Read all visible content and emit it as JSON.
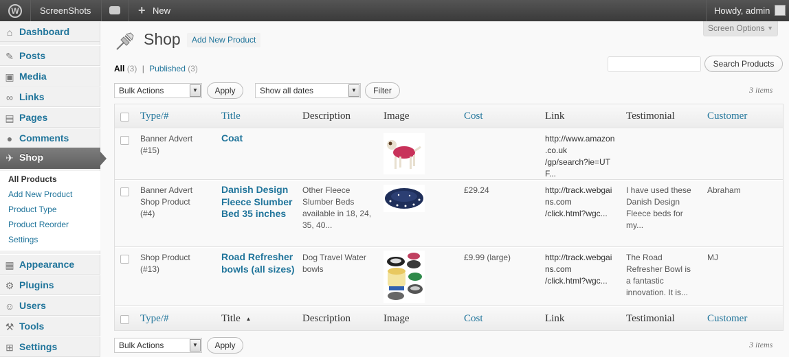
{
  "adminbar": {
    "site_name": "ScreenShots",
    "new_label": "New",
    "howdy": "Howdy, admin"
  },
  "screen_options": "Screen Options",
  "sidebar": {
    "items": [
      {
        "label": "Dashboard",
        "icon": "dashboard-icon"
      },
      {
        "label": "Posts",
        "icon": "pin-icon"
      },
      {
        "label": "Media",
        "icon": "media-icon"
      },
      {
        "label": "Links",
        "icon": "link-icon"
      },
      {
        "label": "Pages",
        "icon": "pages-icon"
      },
      {
        "label": "Comments",
        "icon": "comment-icon"
      },
      {
        "label": "Shop",
        "icon": "shop-icon"
      },
      {
        "label": "Appearance",
        "icon": "appearance-icon"
      },
      {
        "label": "Plugins",
        "icon": "plugin-icon"
      },
      {
        "label": "Users",
        "icon": "users-icon"
      },
      {
        "label": "Tools",
        "icon": "tools-icon"
      },
      {
        "label": "Settings",
        "icon": "settings-icon"
      }
    ],
    "submenu": [
      "All Products",
      "Add New Product",
      "Product Type",
      "Product Reorder",
      "Settings"
    ]
  },
  "page": {
    "title": "Shop",
    "add_new": "Add New Product",
    "filter_all": "All",
    "filter_all_count": "(3)",
    "filter_sep": "|",
    "filter_published": "Published",
    "filter_published_count": "(3)",
    "search_button": "Search Products",
    "bulk_actions": "Bulk Actions",
    "apply": "Apply",
    "dates": "Show all dates",
    "filter": "Filter",
    "items_count": "3 items"
  },
  "table": {
    "columns": [
      "Type/#",
      "Title",
      "Description",
      "Image",
      "Cost",
      "Link",
      "Testimonial",
      "Customer"
    ],
    "rows": [
      {
        "type": [
          "Banner Advert",
          "(#15)"
        ],
        "title": [
          "Coat"
        ],
        "description": [],
        "cost": "",
        "link": [
          "http://www.amazon",
          ".co.uk",
          "/gp/search?ie=UT",
          "F..."
        ],
        "testimonial": [],
        "customer": ""
      },
      {
        "type": [
          "Banner Advert",
          "Shop Product",
          "(#4)"
        ],
        "title": [
          "Danish Design",
          "Fleece Slumber",
          "Bed 35 inches"
        ],
        "description": [
          "Other Fleece",
          "Slumber Beds",
          "available in 18, 24,",
          "35, 40..."
        ],
        "cost": "£29.24",
        "link": [
          "http://track.webgai",
          "ns.com",
          "/click.html?wgc..."
        ],
        "testimonial": [
          "I have used these",
          "Danish Design",
          "Fleece beds for",
          "my..."
        ],
        "customer": "Abraham"
      },
      {
        "type": [
          "Shop Product",
          "(#13)"
        ],
        "title": [
          "Road Refresher",
          "bowls (all sizes)"
        ],
        "description": [
          "Dog Travel Water",
          "bowls"
        ],
        "cost": "£9.99 (large)",
        "link": [
          "http://track.webgai",
          "ns.com",
          "/click.html?wgc..."
        ],
        "testimonial": [
          "The Road",
          "Refresher Bowl is",
          "a fantastic",
          "innovation. It is..."
        ],
        "customer": "MJ"
      }
    ],
    "sort_indicator": "▲"
  },
  "colors": {
    "link": "#21759b",
    "adminbar": "#464646",
    "current_menu": "#6a6a6a"
  }
}
